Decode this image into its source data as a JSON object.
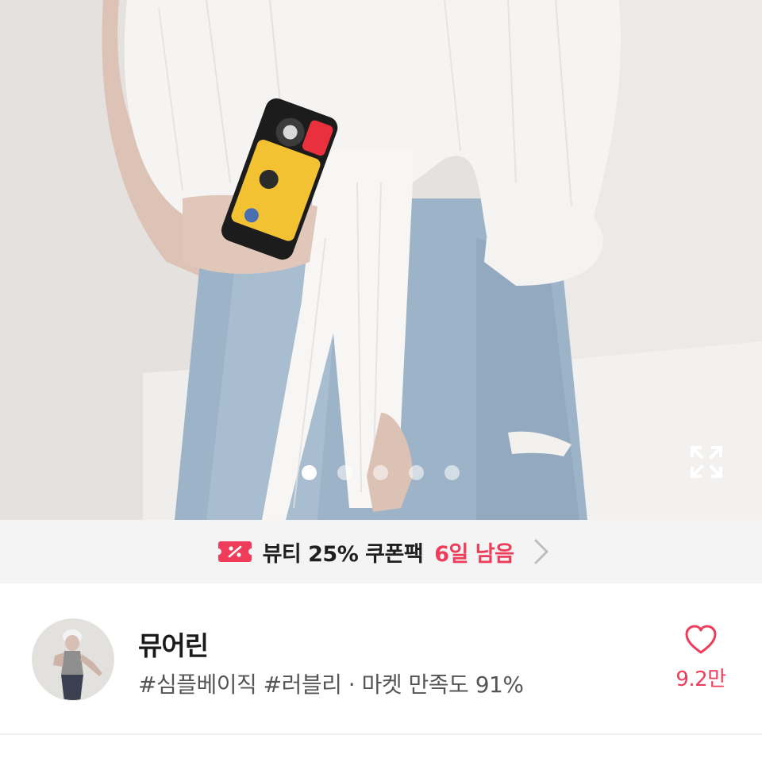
{
  "product": {
    "image_count": 5,
    "current_image": 1,
    "expand_icon": "expand-icon"
  },
  "coupon": {
    "icon": "coupon-percent-icon",
    "label": "뷰티 25% 쿠폰팩",
    "days_left": "6일 남음",
    "accent_color": "#ee3c5a"
  },
  "seller": {
    "name": "뮤어린",
    "meta": "#심플베이직 #러블리 · 마켓 만족도 91%",
    "like_icon": "heart-icon",
    "like_count": "9.2만"
  }
}
